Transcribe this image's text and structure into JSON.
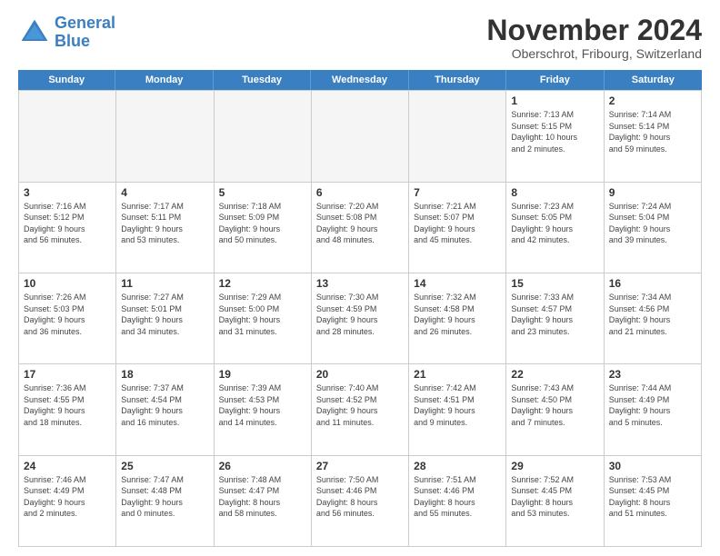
{
  "logo": {
    "line1": "General",
    "line2": "Blue"
  },
  "title": "November 2024",
  "subtitle": "Oberschrot, Fribourg, Switzerland",
  "header_days": [
    "Sunday",
    "Monday",
    "Tuesday",
    "Wednesday",
    "Thursday",
    "Friday",
    "Saturday"
  ],
  "weeks": [
    [
      {
        "day": "",
        "info": "",
        "empty": true
      },
      {
        "day": "",
        "info": "",
        "empty": true
      },
      {
        "day": "",
        "info": "",
        "empty": true
      },
      {
        "day": "",
        "info": "",
        "empty": true
      },
      {
        "day": "",
        "info": "",
        "empty": true
      },
      {
        "day": "1",
        "info": "Sunrise: 7:13 AM\nSunset: 5:15 PM\nDaylight: 10 hours\nand 2 minutes.",
        "empty": false
      },
      {
        "day": "2",
        "info": "Sunrise: 7:14 AM\nSunset: 5:14 PM\nDaylight: 9 hours\nand 59 minutes.",
        "empty": false
      }
    ],
    [
      {
        "day": "3",
        "info": "Sunrise: 7:16 AM\nSunset: 5:12 PM\nDaylight: 9 hours\nand 56 minutes.",
        "empty": false
      },
      {
        "day": "4",
        "info": "Sunrise: 7:17 AM\nSunset: 5:11 PM\nDaylight: 9 hours\nand 53 minutes.",
        "empty": false
      },
      {
        "day": "5",
        "info": "Sunrise: 7:18 AM\nSunset: 5:09 PM\nDaylight: 9 hours\nand 50 minutes.",
        "empty": false
      },
      {
        "day": "6",
        "info": "Sunrise: 7:20 AM\nSunset: 5:08 PM\nDaylight: 9 hours\nand 48 minutes.",
        "empty": false
      },
      {
        "day": "7",
        "info": "Sunrise: 7:21 AM\nSunset: 5:07 PM\nDaylight: 9 hours\nand 45 minutes.",
        "empty": false
      },
      {
        "day": "8",
        "info": "Sunrise: 7:23 AM\nSunset: 5:05 PM\nDaylight: 9 hours\nand 42 minutes.",
        "empty": false
      },
      {
        "day": "9",
        "info": "Sunrise: 7:24 AM\nSunset: 5:04 PM\nDaylight: 9 hours\nand 39 minutes.",
        "empty": false
      }
    ],
    [
      {
        "day": "10",
        "info": "Sunrise: 7:26 AM\nSunset: 5:03 PM\nDaylight: 9 hours\nand 36 minutes.",
        "empty": false
      },
      {
        "day": "11",
        "info": "Sunrise: 7:27 AM\nSunset: 5:01 PM\nDaylight: 9 hours\nand 34 minutes.",
        "empty": false
      },
      {
        "day": "12",
        "info": "Sunrise: 7:29 AM\nSunset: 5:00 PM\nDaylight: 9 hours\nand 31 minutes.",
        "empty": false
      },
      {
        "day": "13",
        "info": "Sunrise: 7:30 AM\nSunset: 4:59 PM\nDaylight: 9 hours\nand 28 minutes.",
        "empty": false
      },
      {
        "day": "14",
        "info": "Sunrise: 7:32 AM\nSunset: 4:58 PM\nDaylight: 9 hours\nand 26 minutes.",
        "empty": false
      },
      {
        "day": "15",
        "info": "Sunrise: 7:33 AM\nSunset: 4:57 PM\nDaylight: 9 hours\nand 23 minutes.",
        "empty": false
      },
      {
        "day": "16",
        "info": "Sunrise: 7:34 AM\nSunset: 4:56 PM\nDaylight: 9 hours\nand 21 minutes.",
        "empty": false
      }
    ],
    [
      {
        "day": "17",
        "info": "Sunrise: 7:36 AM\nSunset: 4:55 PM\nDaylight: 9 hours\nand 18 minutes.",
        "empty": false
      },
      {
        "day": "18",
        "info": "Sunrise: 7:37 AM\nSunset: 4:54 PM\nDaylight: 9 hours\nand 16 minutes.",
        "empty": false
      },
      {
        "day": "19",
        "info": "Sunrise: 7:39 AM\nSunset: 4:53 PM\nDaylight: 9 hours\nand 14 minutes.",
        "empty": false
      },
      {
        "day": "20",
        "info": "Sunrise: 7:40 AM\nSunset: 4:52 PM\nDaylight: 9 hours\nand 11 minutes.",
        "empty": false
      },
      {
        "day": "21",
        "info": "Sunrise: 7:42 AM\nSunset: 4:51 PM\nDaylight: 9 hours\nand 9 minutes.",
        "empty": false
      },
      {
        "day": "22",
        "info": "Sunrise: 7:43 AM\nSunset: 4:50 PM\nDaylight: 9 hours\nand 7 minutes.",
        "empty": false
      },
      {
        "day": "23",
        "info": "Sunrise: 7:44 AM\nSunset: 4:49 PM\nDaylight: 9 hours\nand 5 minutes.",
        "empty": false
      }
    ],
    [
      {
        "day": "24",
        "info": "Sunrise: 7:46 AM\nSunset: 4:49 PM\nDaylight: 9 hours\nand 2 minutes.",
        "empty": false
      },
      {
        "day": "25",
        "info": "Sunrise: 7:47 AM\nSunset: 4:48 PM\nDaylight: 9 hours\nand 0 minutes.",
        "empty": false
      },
      {
        "day": "26",
        "info": "Sunrise: 7:48 AM\nSunset: 4:47 PM\nDaylight: 8 hours\nand 58 minutes.",
        "empty": false
      },
      {
        "day": "27",
        "info": "Sunrise: 7:50 AM\nSunset: 4:46 PM\nDaylight: 8 hours\nand 56 minutes.",
        "empty": false
      },
      {
        "day": "28",
        "info": "Sunrise: 7:51 AM\nSunset: 4:46 PM\nDaylight: 8 hours\nand 55 minutes.",
        "empty": false
      },
      {
        "day": "29",
        "info": "Sunrise: 7:52 AM\nSunset: 4:45 PM\nDaylight: 8 hours\nand 53 minutes.",
        "empty": false
      },
      {
        "day": "30",
        "info": "Sunrise: 7:53 AM\nSunset: 4:45 PM\nDaylight: 8 hours\nand 51 minutes.",
        "empty": false
      }
    ]
  ]
}
